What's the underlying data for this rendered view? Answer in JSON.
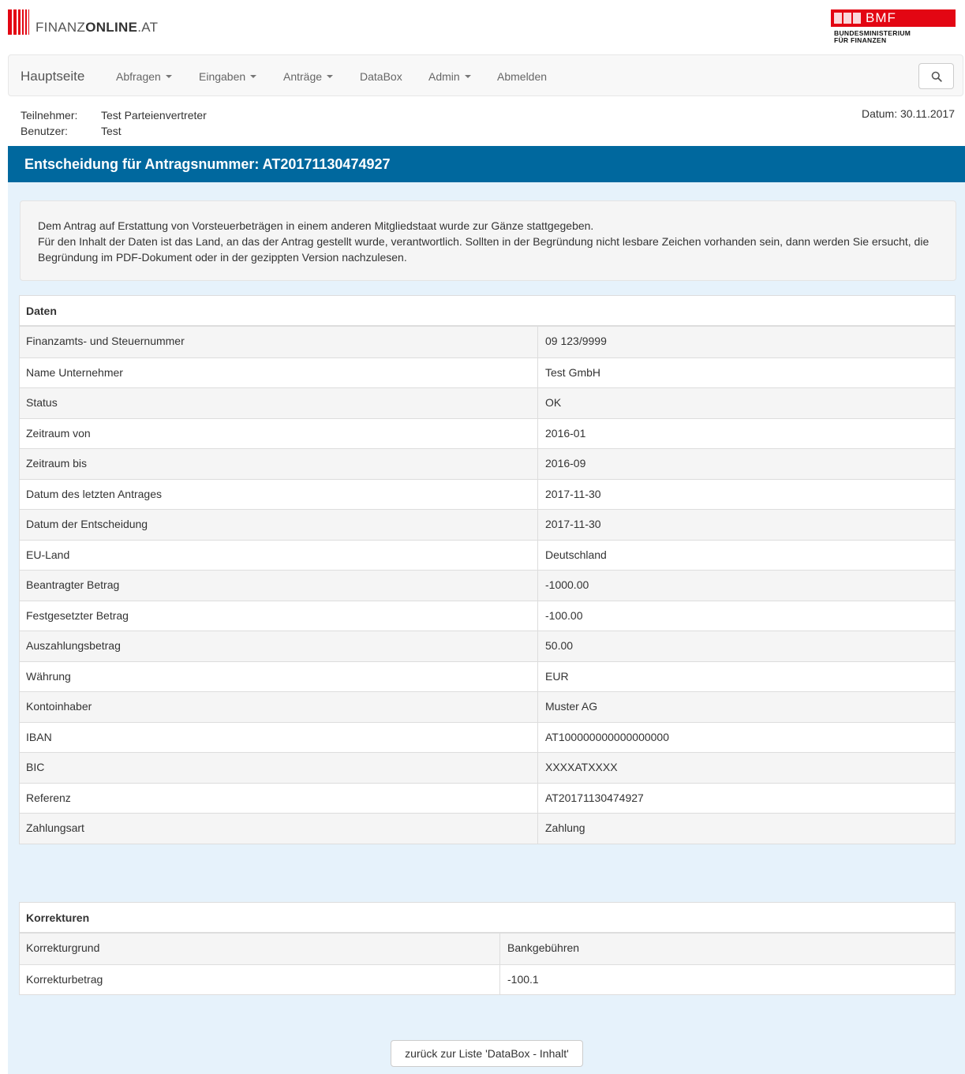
{
  "brand": {
    "logo_text_light": "FINANZ",
    "logo_text_bold": "ONLINE",
    "logo_text_suffix": ".AT",
    "bmf_text": "BMF",
    "bmf_sub_line1": "BUNDESMINISTERIUM",
    "bmf_sub_line2": "FÜR FINANZEN",
    "accent": "#e30613"
  },
  "navbar": {
    "brand": "Hauptseite",
    "items": [
      {
        "label": "Abfragen",
        "dropdown": true
      },
      {
        "label": "Eingaben",
        "dropdown": true
      },
      {
        "label": "Anträge",
        "dropdown": true
      },
      {
        "label": "DataBox",
        "dropdown": false
      },
      {
        "label": "Admin",
        "dropdown": true
      },
      {
        "label": "Abmelden",
        "dropdown": false
      }
    ],
    "search_icon": "search-icon"
  },
  "info": {
    "teilnehmer_label": "Teilnehmer:",
    "teilnehmer_value": "Test Parteienvertreter",
    "benutzer_label": "Benutzer:",
    "benutzer_value": "Test",
    "datum": "Datum: 30.11.2017"
  },
  "title": "Entscheidung für Antragsnummer: AT20171130474927",
  "title_bg": "#00689e",
  "notice": {
    "line1": "Dem Antrag auf Erstattung von Vorsteuerbeträgen in einem anderen Mitgliedstaat wurde zur Gänze stattgegeben.",
    "line2": "Für den Inhalt der Daten ist das Land, an das der Antrag gestellt wurde, verantwortlich. Sollten in der Begründung nicht lesbare Zeichen vorhanden sein, dann werden Sie ersucht, die Begründung im PDF-Dokument oder in der gezippten Version nachzulesen."
  },
  "daten": {
    "heading": "Daten",
    "rows": [
      {
        "label": "Finanzamts- und Steuernummer",
        "value": "09 123/9999"
      },
      {
        "label": "Name Unternehmer",
        "value": "Test GmbH"
      },
      {
        "label": "Status",
        "value": "OK"
      },
      {
        "label": "Zeitraum von",
        "value": "2016-01"
      },
      {
        "label": "Zeitraum bis",
        "value": "2016-09"
      },
      {
        "label": "Datum des letzten Antrages",
        "value": "2017-11-30"
      },
      {
        "label": "Datum der Entscheidung",
        "value": "2017-11-30"
      },
      {
        "label": "EU-Land",
        "value": "Deutschland"
      },
      {
        "label": "Beantragter Betrag",
        "value": "-1000.00"
      },
      {
        "label": "Festgesetzter Betrag",
        "value": "-100.00"
      },
      {
        "label": "Auszahlungsbetrag",
        "value": "50.00"
      },
      {
        "label": "Währung",
        "value": "EUR"
      },
      {
        "label": "Kontoinhaber",
        "value": "Muster AG"
      },
      {
        "label": "IBAN",
        "value": "AT100000000000000000"
      },
      {
        "label": "BIC",
        "value": "XXXXATXXXX"
      },
      {
        "label": "Referenz",
        "value": "AT20171130474927"
      },
      {
        "label": "Zahlungsart",
        "value": "Zahlung"
      }
    ]
  },
  "korrekturen": {
    "heading": "Korrekturen",
    "rows": [
      {
        "label": "Korrekturgrund",
        "value": "Bankgebühren"
      },
      {
        "label": "Korrekturbetrag",
        "value": "-100.1"
      }
    ]
  },
  "back_button": "zurück zur Liste 'DataBox - Inhalt'"
}
